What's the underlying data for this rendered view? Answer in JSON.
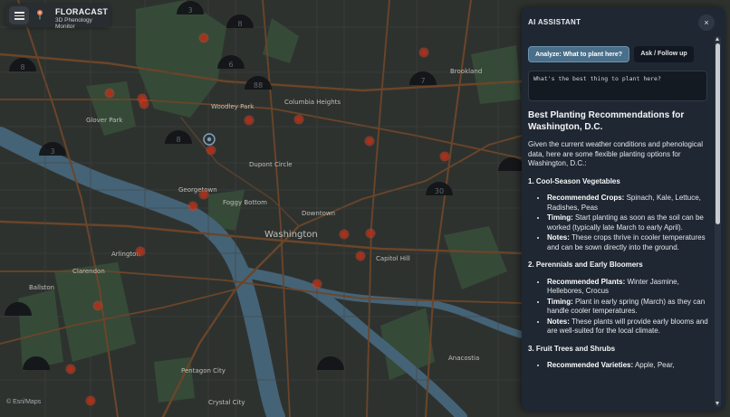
{
  "app": {
    "title": "FLORACAST",
    "subtitle": "3D Phenology Monitor"
  },
  "map": {
    "attribution": "© Esri/Maps",
    "labels": [
      {
        "text": "Washington",
        "kind": "city"
      },
      {
        "text": "Arlington",
        "kind": "area"
      },
      {
        "text": "Woodley Park",
        "kind": "area"
      },
      {
        "text": "Columbia Heights",
        "kind": "area"
      },
      {
        "text": "Brookland",
        "kind": "area"
      },
      {
        "text": "Glover Park",
        "kind": "area"
      },
      {
        "text": "Dupont Circle",
        "kind": "area"
      },
      {
        "text": "Georgetown",
        "kind": "area"
      },
      {
        "text": "Foggy Bottom",
        "kind": "area"
      },
      {
        "text": "Downtown",
        "kind": "area"
      },
      {
        "text": "Capitol Hill",
        "kind": "area"
      },
      {
        "text": "Clarendon",
        "kind": "area"
      },
      {
        "text": "Ballston",
        "kind": "area"
      },
      {
        "text": "Pentagon City",
        "kind": "area"
      },
      {
        "text": "Crystal City",
        "kind": "area"
      },
      {
        "text": "Anacostia",
        "kind": "area"
      }
    ],
    "hexagon_markers": [
      "3",
      "8",
      "6",
      "88",
      "7",
      "8",
      "3",
      "8",
      "30"
    ]
  },
  "assistant": {
    "title": "AI ASSISTANT",
    "close_label": "×",
    "analyze_button": "Analyze: What to plant here?",
    "ask_button": "Ask / Follow up",
    "query_text": "What's the best thing to plant here?",
    "response": {
      "heading": "Best Planting Recommendations for Washington, D.C.",
      "intro": "Given the current weather conditions and phenological data, here are some flexible planting options for Washington, D.C.:",
      "sections": [
        {
          "title": "1. Cool-Season Vegetables",
          "items": [
            {
              "label": "Recommended Crops:",
              "text": " Spinach, Kale, Lettuce, Radishes, Peas"
            },
            {
              "label": "Timing:",
              "text": " Start planting as soon as the soil can be worked (typically late March to early April)."
            },
            {
              "label": "Notes:",
              "text": " These crops thrive in cooler temperatures and can be sown directly into the ground."
            }
          ]
        },
        {
          "title": "2. Perennials and Early Bloomers",
          "items": [
            {
              "label": "Recommended Plants:",
              "text": " Winter Jasmine, Hellebores, Crocus"
            },
            {
              "label": "Timing:",
              "text": " Plant in early spring (March) as they can handle cooler temperatures."
            },
            {
              "label": "Notes:",
              "text": " These plants will provide early blooms and are well-suited for the local climate."
            }
          ]
        },
        {
          "title": "3. Fruit Trees and Shrubs",
          "items": [
            {
              "label": "Recommended Varieties:",
              "text": " Apple, Pear,"
            }
          ]
        }
      ]
    }
  },
  "colors": {
    "panel_bg": "#1f2732",
    "accent_button": "#4a6f8a",
    "marker_red": "#e0492c",
    "map_water": "#4f7187",
    "map_park": "#3e5540"
  }
}
